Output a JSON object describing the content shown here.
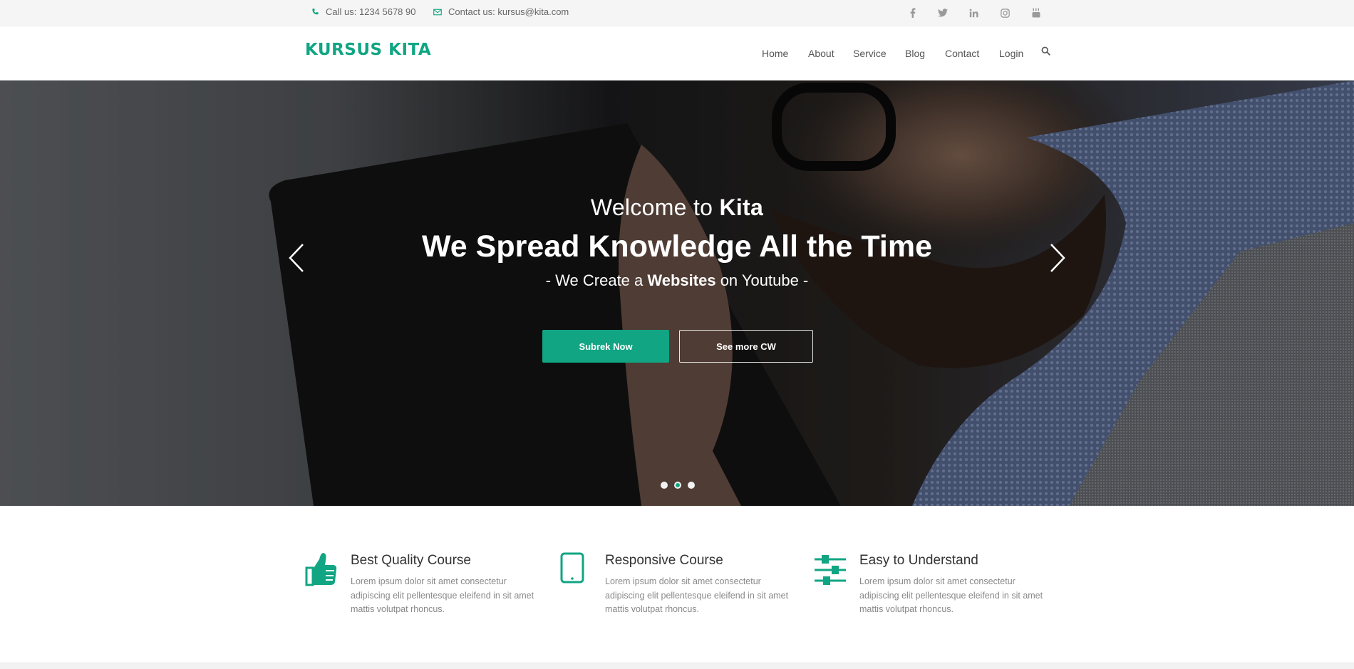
{
  "topbar": {
    "phone": "Call us: 1234 5678 90",
    "email": "Contact us: kursus@kita.com",
    "social": [
      "facebook-icon",
      "twitter-icon",
      "linkedin-icon",
      "instagram-icon",
      "youtube-icon"
    ]
  },
  "header": {
    "logo": "KURSUS KITA",
    "nav": [
      {
        "label": "Home"
      },
      {
        "label": "About"
      },
      {
        "label": "Service"
      },
      {
        "label": "Blog"
      },
      {
        "label": "Contact"
      },
      {
        "label": "Login"
      }
    ],
    "search_icon": "search-icon"
  },
  "hero": {
    "welcome_prefix": "Welcome to ",
    "welcome_brand": "Kita",
    "headline": "We Spread Knowledge All the Time",
    "sub_prefix": "- We Create a ",
    "sub_bold": "Websites",
    "sub_suffix": " on Youtube -",
    "primary_button": "Subrek Now",
    "secondary_button": "See more CW",
    "slides_total": 3,
    "active_slide": 2
  },
  "features": [
    {
      "icon": "thumbs-up-icon",
      "title": "Best Quality Course",
      "desc": "Lorem ipsum dolor sit amet consectetur adipiscing elit pellentesque eleifend in sit amet mattis volutpat rhoncus."
    },
    {
      "icon": "tablet-icon",
      "title": "Responsive Course",
      "desc": "Lorem ipsum dolor sit amet consectetur adipiscing elit pellentesque eleifend in sit amet mattis volutpat rhoncus."
    },
    {
      "icon": "sliders-icon",
      "title": "Easy to Understand",
      "desc": "Lorem ipsum dolor sit amet consectetur adipiscing elit pellentesque eleifend in sit amet mattis volutpat rhoncus."
    }
  ],
  "colors": {
    "accent": "#11a583",
    "topbar_bg": "#f5f5f5",
    "text": "#555555"
  }
}
